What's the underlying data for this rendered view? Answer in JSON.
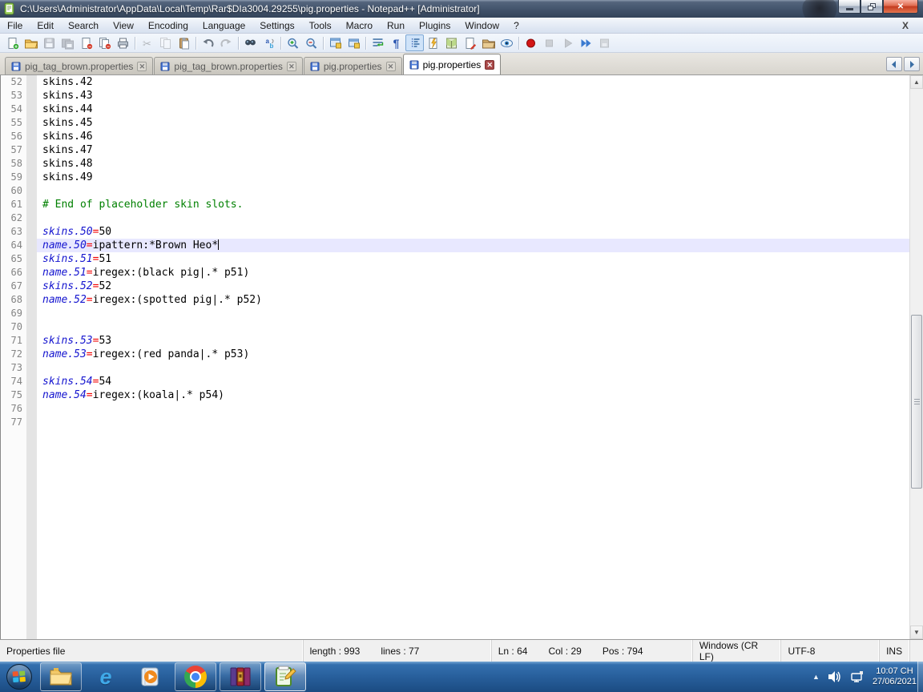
{
  "window": {
    "title": "C:\\Users\\Administrator\\AppData\\Local\\Temp\\Rar$DIa3004.29255\\pig.properties - Notepad++ [Administrator]",
    "controls": {
      "minimize": "minimize",
      "restore": "restore",
      "close": "close"
    }
  },
  "menu": {
    "items": [
      "File",
      "Edit",
      "Search",
      "View",
      "Encoding",
      "Language",
      "Settings",
      "Tools",
      "Macro",
      "Run",
      "Plugins",
      "Window",
      "?"
    ],
    "close_x": "X"
  },
  "toolbar": {
    "icons": [
      {
        "name": "new-file-icon"
      },
      {
        "name": "open-file-icon"
      },
      {
        "name": "save-icon",
        "disabled": true
      },
      {
        "name": "save-all-icon",
        "disabled": true
      },
      {
        "name": "close-file-icon"
      },
      {
        "name": "close-all-icon"
      },
      {
        "name": "print-icon"
      },
      {
        "sep": true
      },
      {
        "name": "cut-icon",
        "disabled": true
      },
      {
        "name": "copy-icon",
        "disabled": true
      },
      {
        "name": "paste-icon"
      },
      {
        "sep": true
      },
      {
        "name": "undo-icon"
      },
      {
        "name": "redo-icon",
        "disabled": true
      },
      {
        "sep": true
      },
      {
        "name": "find-icon"
      },
      {
        "name": "replace-icon"
      },
      {
        "sep": true
      },
      {
        "name": "zoom-in-icon"
      },
      {
        "name": "zoom-out-icon"
      },
      {
        "sep": true
      },
      {
        "name": "sync-vertical-icon"
      },
      {
        "name": "sync-horizontal-icon"
      },
      {
        "sep": true
      },
      {
        "name": "word-wrap-icon"
      },
      {
        "name": "show-all-chars-icon"
      },
      {
        "name": "show-indent-guide-icon",
        "pressed": true
      },
      {
        "name": "function-list-icon"
      },
      {
        "name": "doc-map-icon"
      },
      {
        "name": "doc-switcher-icon"
      },
      {
        "name": "folder-as-workspace-icon"
      },
      {
        "name": "monitoring-icon"
      },
      {
        "sep": true
      },
      {
        "name": "macro-record-icon"
      },
      {
        "name": "macro-stop-icon",
        "disabled": true
      },
      {
        "name": "macro-play-icon",
        "disabled": true
      },
      {
        "name": "macro-run-multiple-icon"
      },
      {
        "name": "macro-save-icon",
        "disabled": true
      }
    ]
  },
  "tabs": {
    "items": [
      {
        "label": "pig_tag_brown.properties",
        "active": false
      },
      {
        "label": "pig_tag_brown.properties",
        "active": false
      },
      {
        "label": "pig.properties",
        "active": false
      },
      {
        "label": "pig.properties",
        "active": true
      }
    ]
  },
  "editor": {
    "lines": [
      {
        "num": 52,
        "segs": [
          {
            "c": "val",
            "t": "skins.42"
          }
        ]
      },
      {
        "num": 53,
        "segs": [
          {
            "c": "val",
            "t": "skins.43"
          }
        ]
      },
      {
        "num": 54,
        "segs": [
          {
            "c": "val",
            "t": "skins.44"
          }
        ]
      },
      {
        "num": 55,
        "segs": [
          {
            "c": "val",
            "t": "skins.45"
          }
        ]
      },
      {
        "num": 56,
        "segs": [
          {
            "c": "val",
            "t": "skins.46"
          }
        ]
      },
      {
        "num": 57,
        "segs": [
          {
            "c": "val",
            "t": "skins.47"
          }
        ]
      },
      {
        "num": 58,
        "segs": [
          {
            "c": "val",
            "t": "skins.48"
          }
        ]
      },
      {
        "num": 59,
        "segs": [
          {
            "c": "val",
            "t": "skins.49"
          }
        ]
      },
      {
        "num": 60,
        "segs": []
      },
      {
        "num": 61,
        "segs": [
          {
            "c": "comment",
            "t": "# End of placeholder skin slots."
          }
        ]
      },
      {
        "num": 62,
        "segs": []
      },
      {
        "num": 63,
        "segs": [
          {
            "c": "key",
            "t": "skins.50"
          },
          {
            "c": "eq",
            "t": "="
          },
          {
            "c": "val",
            "t": "50"
          }
        ]
      },
      {
        "num": 64,
        "current": true,
        "caret": true,
        "segs": [
          {
            "c": "key",
            "t": "name.50"
          },
          {
            "c": "eq",
            "t": "="
          },
          {
            "c": "val",
            "t": "ipattern:*Brown Heo*"
          }
        ]
      },
      {
        "num": 65,
        "segs": [
          {
            "c": "key",
            "t": "skins.51"
          },
          {
            "c": "eq",
            "t": "="
          },
          {
            "c": "val",
            "t": "51"
          }
        ]
      },
      {
        "num": 66,
        "segs": [
          {
            "c": "key",
            "t": "name.51"
          },
          {
            "c": "eq",
            "t": "="
          },
          {
            "c": "val",
            "t": "iregex:(black pig|.* p51)"
          }
        ]
      },
      {
        "num": 67,
        "segs": [
          {
            "c": "key",
            "t": "skins.52"
          },
          {
            "c": "eq",
            "t": "="
          },
          {
            "c": "val",
            "t": "52"
          }
        ]
      },
      {
        "num": 68,
        "segs": [
          {
            "c": "key",
            "t": "name.52"
          },
          {
            "c": "eq",
            "t": "="
          },
          {
            "c": "val",
            "t": "iregex:(spotted pig|.* p52)"
          }
        ]
      },
      {
        "num": 69,
        "segs": []
      },
      {
        "num": 70,
        "segs": []
      },
      {
        "num": 71,
        "segs": [
          {
            "c": "key",
            "t": "skins.53"
          },
          {
            "c": "eq",
            "t": "="
          },
          {
            "c": "val",
            "t": "53"
          }
        ]
      },
      {
        "num": 72,
        "segs": [
          {
            "c": "key",
            "t": "name.53"
          },
          {
            "c": "eq",
            "t": "="
          },
          {
            "c": "val",
            "t": "iregex:(red panda|.* p53)"
          }
        ]
      },
      {
        "num": 73,
        "segs": []
      },
      {
        "num": 74,
        "segs": [
          {
            "c": "key",
            "t": "skins.54"
          },
          {
            "c": "eq",
            "t": "="
          },
          {
            "c": "val",
            "t": "54"
          }
        ]
      },
      {
        "num": 75,
        "segs": [
          {
            "c": "key",
            "t": "name.54"
          },
          {
            "c": "eq",
            "t": "="
          },
          {
            "c": "val",
            "t": "iregex:(koala|.* p54)"
          }
        ]
      },
      {
        "num": 76,
        "segs": []
      },
      {
        "num": 77,
        "segs": []
      }
    ]
  },
  "status": {
    "doctype": "Properties file",
    "length": "length : 993",
    "lines": "lines : 77",
    "ln": "Ln : 64",
    "col": "Col : 29",
    "pos": "Pos : 794",
    "eol": "Windows (CR LF)",
    "encoding": "UTF-8",
    "insert_mode": "INS"
  },
  "taskbar": {
    "apps": [
      {
        "name": "start-button",
        "icon": "windows-orb-icon",
        "open": false,
        "active": false
      },
      {
        "name": "taskbar-item-explorer",
        "icon": "explorer-icon",
        "open": true,
        "active": false
      },
      {
        "name": "taskbar-item-internet-explorer",
        "icon": "internet-explorer-icon",
        "open": false,
        "active": false
      },
      {
        "name": "taskbar-item-media-player",
        "icon": "media-player-icon",
        "open": false,
        "active": false
      },
      {
        "name": "taskbar-item-chrome",
        "icon": "chrome-icon",
        "open": true,
        "active": false
      },
      {
        "name": "taskbar-item-winrar",
        "icon": "winrar-icon",
        "open": true,
        "active": false
      },
      {
        "name": "taskbar-item-notepad-plus-plus",
        "icon": "notepad-plus-plus-icon",
        "open": true,
        "active": true
      }
    ],
    "tray": {
      "icons": [
        "tray-expand-arrow-icon",
        "speaker-icon",
        "network-icon"
      ],
      "time": "10:07 CH",
      "date": "27/06/2021"
    }
  },
  "colors": {
    "titlebar": "#42536b",
    "taskbar": "#29619e",
    "current_line": "#e8e8ff",
    "key_blue": "#1515cf",
    "assign_red": "#f00000",
    "comment_green": "#008000",
    "active_tab_close": "#a94a4a"
  }
}
